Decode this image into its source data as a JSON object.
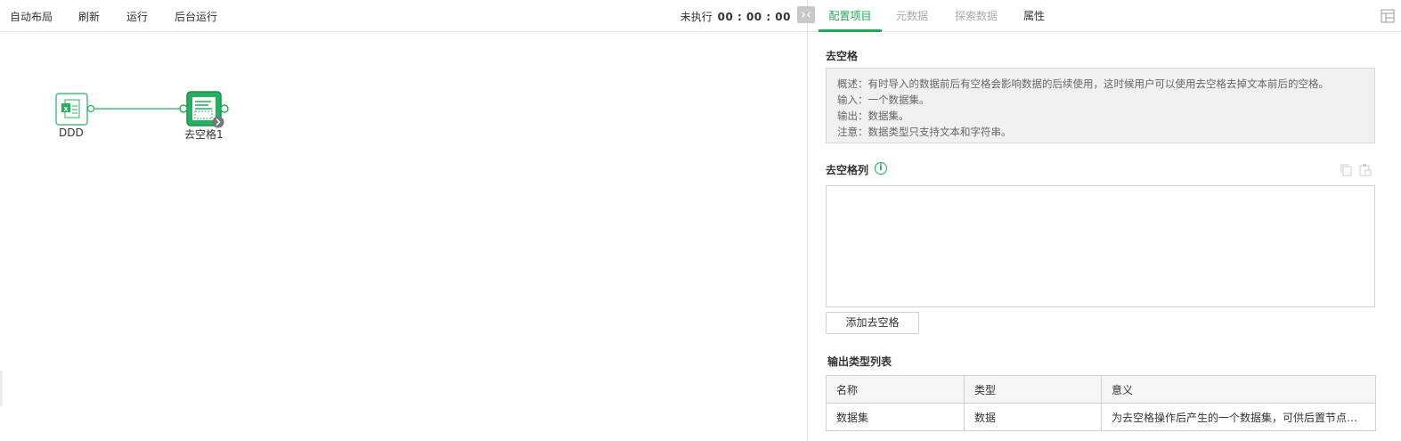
{
  "toolbar": {
    "auto_layout": "自动布局",
    "refresh": "刷新",
    "run": "运行",
    "background_run": "后台运行",
    "status_label": "未执行",
    "status_time": "00 : 00 : 00"
  },
  "canvas": {
    "nodes": [
      {
        "label": "DDD",
        "icon": "excel-dataset-icon"
      },
      {
        "label": "去空格1",
        "icon": "trim-spaces-node-icon"
      }
    ]
  },
  "tabs": [
    {
      "label": "配置项目",
      "active": true
    },
    {
      "label": "元数据",
      "active": false
    },
    {
      "label": "探索数据",
      "active": false
    },
    {
      "label": "属性",
      "active": false
    }
  ],
  "panel": {
    "section_title": "去空格",
    "description": [
      "概述：有时导入的数据前后有空格会影响数据的后续使用，这时候用户可以使用去空格去掉文本前后的空格。",
      "输入：一个数据集。",
      "输出：数据集。",
      "注意：数据类型只支持文本和字符串。"
    ],
    "columns_title": "去空格列",
    "add_button": "添加去空格",
    "output_title": "输出类型列表",
    "table": {
      "headers": [
        "名称",
        "类型",
        "意义"
      ],
      "rows": [
        [
          "数据集",
          "数据",
          "为去空格操作后产生的一个数据集，可供后置节点使用..."
        ]
      ]
    }
  },
  "colors": {
    "accent": "#1aac56",
    "node_green": "#27ae60"
  }
}
